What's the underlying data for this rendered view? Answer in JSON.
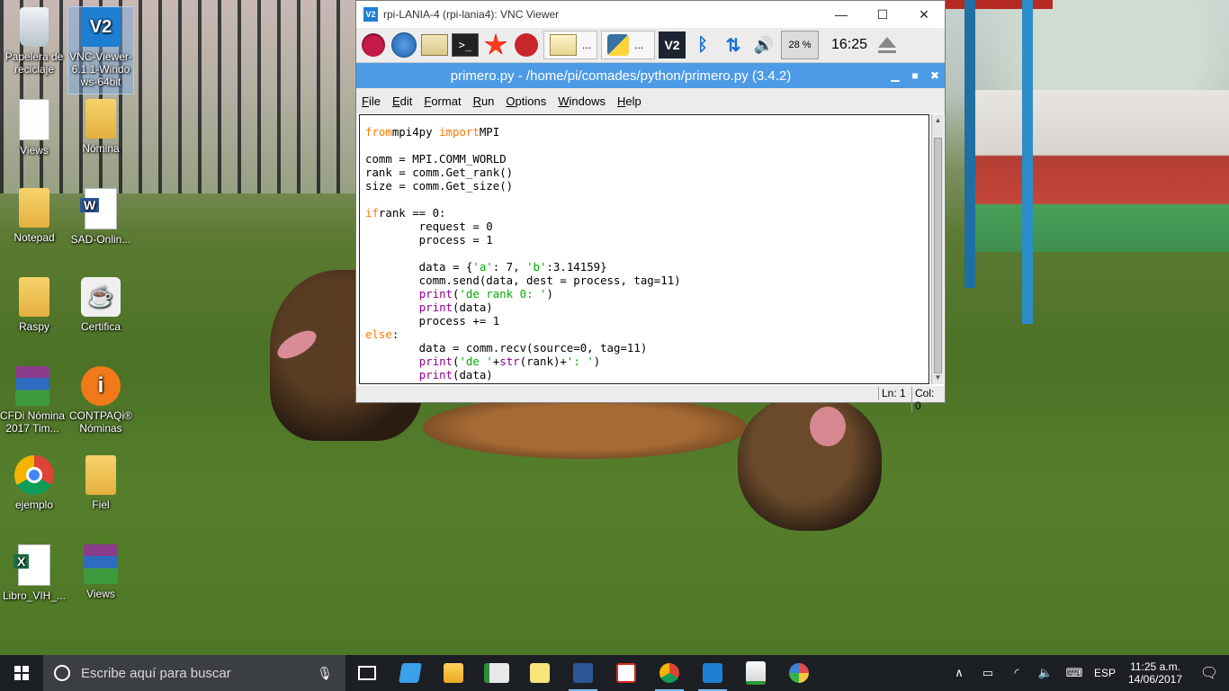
{
  "desktop": {
    "icons": [
      {
        "label": "Papelera de reciclaje",
        "icon": "recycle-bin-icon"
      },
      {
        "label": "VNC-Viewer-6.1.1-Windows-64bit",
        "icon": "vnc-viewer-icon"
      },
      {
        "label": "Views",
        "icon": "document-icon"
      },
      {
        "label": "Nómina",
        "icon": "folder-icon"
      },
      {
        "label": "Notepad",
        "icon": "folder-icon"
      },
      {
        "label": "SAD-Onlin...",
        "icon": "word-document-icon"
      },
      {
        "label": "Raspy",
        "icon": "folder-icon"
      },
      {
        "label": "Certifica",
        "icon": "java-icon"
      },
      {
        "label": "CFDi Nómina 2017 Tim...",
        "icon": "winrar-icon"
      },
      {
        "label": "CONTPAQi® Nóminas",
        "icon": "contpaqi-icon"
      },
      {
        "label": "ejemplo",
        "icon": "chrome-icon"
      },
      {
        "label": "Fiel",
        "icon": "folder-icon"
      },
      {
        "label": "Libro_VIH_...",
        "icon": "excel-icon"
      },
      {
        "label": "Views",
        "icon": "winrar-icon"
      }
    ]
  },
  "vnc": {
    "title": "rpi-LANIA-4 (rpi-lania4): VNC Viewer",
    "controls": {
      "minimize": "—",
      "maximize": "☐",
      "close": "✕"
    }
  },
  "pi_panel": {
    "tasks": [
      {
        "label": "..."
      },
      {
        "label": "..."
      }
    ],
    "cpu": "28 %",
    "clock": "16:25"
  },
  "idle": {
    "title": "primero.py - /home/pi/comades/python/primero.py (3.4.2)",
    "menu": [
      "File",
      "Edit",
      "Format",
      "Run",
      "Options",
      "Windows",
      "Help"
    ],
    "status_line": "Ln: 1",
    "status_col": "Col: 0"
  },
  "code": [
    [
      [
        "kw",
        "from"
      ],
      [
        "",
        "mpi4py "
      ],
      [
        "kw",
        "import"
      ],
      [
        "",
        "MPI"
      ]
    ],
    [],
    [
      [
        "",
        "comm = MPI.COMM_WORLD"
      ]
    ],
    [
      [
        "",
        "rank = comm.Get_rank()"
      ]
    ],
    [
      [
        "",
        "size = comm.Get_size()"
      ]
    ],
    [],
    [
      [
        "kw",
        "if"
      ],
      [
        "",
        "rank == 0:"
      ]
    ],
    [
      [
        "",
        "        request = 0"
      ]
    ],
    [
      [
        "",
        "        process = 1"
      ]
    ],
    [],
    [
      [
        "",
        "        data = {"
      ],
      [
        "st",
        "'a'"
      ],
      [
        "",
        ": 7, "
      ],
      [
        "st",
        "'b'"
      ],
      [
        "",
        ":3.14159}"
      ]
    ],
    [
      [
        "",
        "        comm.send(data, dest = process, tag=11)"
      ]
    ],
    [
      [
        "",
        "        "
      ],
      [
        "bi",
        "print"
      ],
      [
        "",
        "("
      ],
      [
        "st",
        "'de rank 0: '"
      ],
      [
        "",
        ")"
      ]
    ],
    [
      [
        "",
        "        "
      ],
      [
        "bi",
        "print"
      ],
      [
        "",
        "(data)"
      ]
    ],
    [
      [
        "",
        "        process += 1"
      ]
    ],
    [
      [
        "kw",
        "else"
      ],
      [
        "",
        ":"
      ]
    ],
    [
      [
        "",
        "        data = comm.recv(source=0, tag=11)"
      ]
    ],
    [
      [
        "",
        "        "
      ],
      [
        "bi",
        "print"
      ],
      [
        "",
        "("
      ],
      [
        "st",
        "'de '"
      ],
      [
        "",
        "+"
      ],
      [
        "bi",
        "str"
      ],
      [
        "",
        "(rank)+"
      ],
      [
        "st",
        "': '"
      ],
      [
        "",
        ")"
      ]
    ],
    [
      [
        "",
        "        "
      ],
      [
        "bi",
        "print"
      ],
      [
        "",
        "(data)"
      ]
    ]
  ],
  "taskbar": {
    "search_placeholder": "Escribe aquí para buscar",
    "language": "ESP",
    "time": "11:25 a.m.",
    "date": "14/06/2017"
  }
}
